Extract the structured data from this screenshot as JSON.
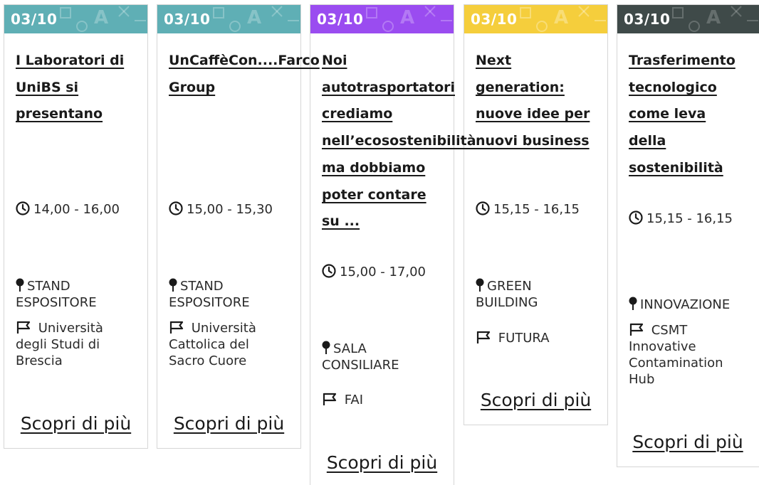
{
  "cards": [
    {
      "date": "03/10",
      "color": "#5fafb5",
      "title": "I Laboratori di\nUniBS si\npresentano",
      "time": "14,00 - 16,00",
      "location": "STAND\nESPOSITORE",
      "organizer": " Università\ndegli Studi di\nBrescia",
      "more_label": "Scopri di più"
    },
    {
      "date": "03/10",
      "color": "#5fafb5",
      "title": "UnCaffèCon....Farco\nGroup",
      "time": "15,00 - 15,30",
      "location": "STAND\nESPOSITORE",
      "organizer": " Università\nCattolica del\nSacro Cuore",
      "more_label": "Scopri di più"
    },
    {
      "date": "03/10",
      "color": "#9a4cf0",
      "title": "Noi\nautotrasportatori\ncrediamo\nnell’ecosostenibilità\nma dobbiamo\npoter contare\nsu ...",
      "time": "15,00 - 17,00",
      "location": "SALA\nCONSILIARE",
      "organizer": " FAI",
      "more_label": "Scopri di più"
    },
    {
      "date": "03/10",
      "color": "#f5ce3c",
      "title": "Next\ngeneration:\nnuove idee per\nnuovi business",
      "time": "15,15 - 16,15",
      "location": "GREEN\nBUILDING",
      "organizer": " FUTURA",
      "more_label": "Scopri di più"
    },
    {
      "date": "03/10",
      "color": "#3f4a49",
      "title": "Trasferimento\ntecnologico\ncome leva\ndella\nsostenibilità",
      "time": "15,15 - 16,15",
      "location": "INNOVAZIONE",
      "organizer": " CSMT\nInnovative\nContamination\nHub",
      "more_label": "Scopri di più"
    }
  ],
  "icons": {
    "time": "clock-icon",
    "location": "pin-icon",
    "organizer": "flag-icon"
  }
}
